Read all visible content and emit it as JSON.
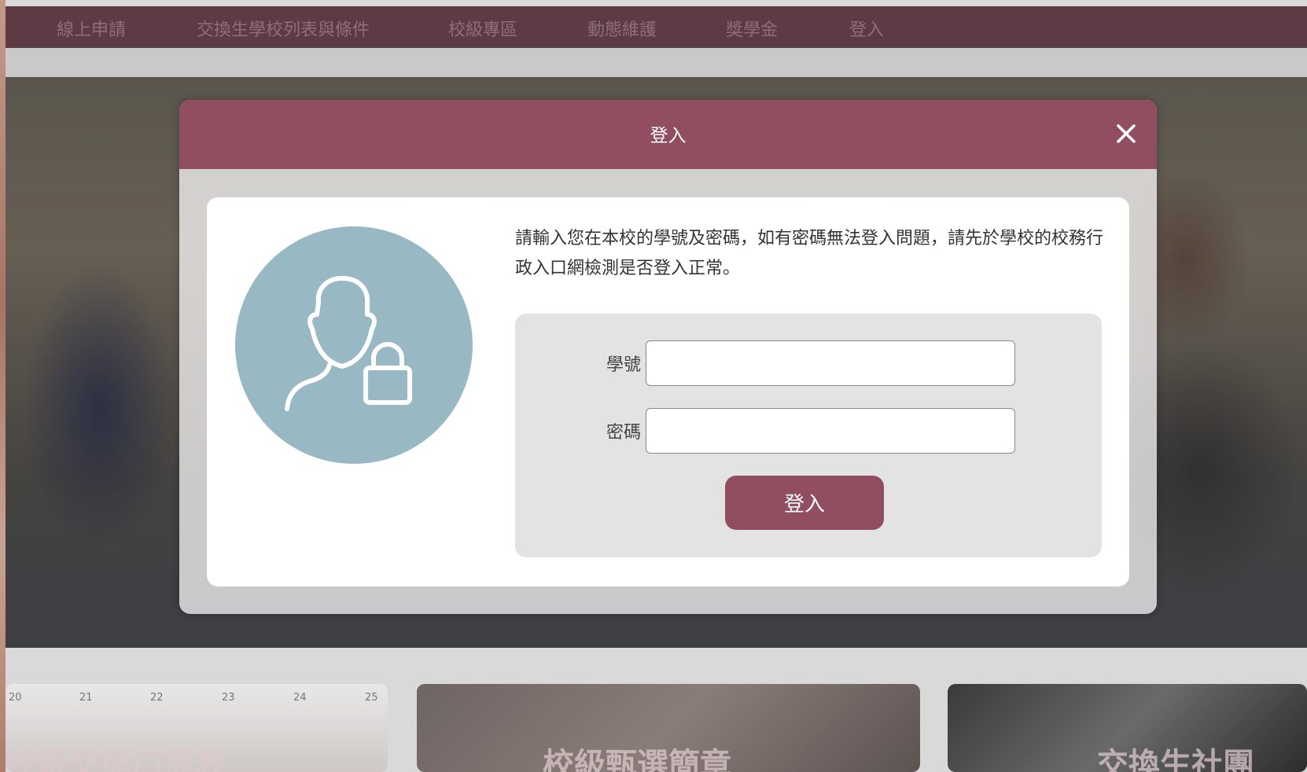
{
  "nav": {
    "items": [
      {
        "label": "線上申請"
      },
      {
        "label": "交換生學校列表與條件"
      },
      {
        "label": "校級專區"
      },
      {
        "label": "動態維護"
      },
      {
        "label": "獎學金"
      },
      {
        "label": "登入"
      }
    ]
  },
  "background_cards": {
    "calendar_numbers": [
      "20",
      "21",
      "22",
      "23",
      "24",
      "25"
    ],
    "captions": [
      "校級交換口提表",
      "校級甄選簡章",
      "交換生社團"
    ]
  },
  "modal": {
    "title": "登入",
    "close_icon": "close-icon",
    "avatar_icon": "user-lock-icon",
    "instructions": "請輸入您在本校的學號及密碼，如有密碼無法登入問題，請先於學校的校務行政入口網檢測是否登入正常。",
    "form": {
      "student_id_label": "學號",
      "student_id_value": "",
      "password_label": "密碼",
      "password_value": "",
      "submit_label": "登入"
    }
  },
  "colors": {
    "nav_bg": "#5e3a44",
    "accent": "#914e61",
    "avatar_bg": "#98b9c3",
    "panel_bg": "#e3e3e3"
  }
}
